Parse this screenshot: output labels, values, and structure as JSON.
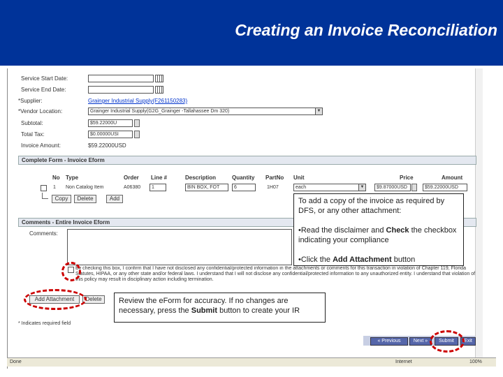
{
  "slide": {
    "title": "Creating an Invoice Reconciliation"
  },
  "form": {
    "service_start_label": "Service Start Date:",
    "service_end_label": "Service End Date:",
    "supplier_label": "*Supplier:",
    "supplier_value": "Grainger Industrial Supply(F261150283)",
    "vendor_location_label": "*Vendor Location:",
    "vendor_location_value": "Grainger Industrial Supply(G2G_Grainger -Tallahassee Dm 320)",
    "subtotal_label": "Subtotal:",
    "subtotal_value": "$59.22000U",
    "total_tax_label": "Total Tax:",
    "total_tax_value": "$0.00000USI",
    "invoice_amount_label": "Invoice Amount:",
    "invoice_amount_value": "$59.22000USD"
  },
  "complete_form": {
    "title": "Complete Form - Invoice Eform",
    "headers": [
      "No",
      "Type",
      "Order",
      "Line #",
      "Description",
      "Quantity",
      "PartNo",
      "Unit",
      "Price",
      "Amount"
    ],
    "row": {
      "no": "1",
      "type": "Non Catalog Item",
      "order": "A06380",
      "line": "1",
      "description": "BIN BOX, FOT",
      "quantity": "6",
      "partno": "1H07",
      "unit": "each",
      "price": "$9.87000USD",
      "amount": "$59.22000USD"
    },
    "copy_button": "Copy",
    "delete_button": "Delete",
    "add_button": "Add"
  },
  "comments_section": {
    "title": "Comments - Entire Invoice Eform",
    "comments_label": "Comments:",
    "disclaimer": "By checking this box, I confirm that I have not disclosed any confidential/protected information in the attachments or comments for this transaction in violation of Chapter 119, Florida Statutes, HIPAA, or any other state and/or federal laws. I understand that I will not disclose any confidential/protected information to any unauthorized entity. I understand that violation of this policy may result in disciplinary action including termination.",
    "add_attachment_button": "Add Attachment",
    "delete_button": "Delete",
    "required_note": "* Indicates required field"
  },
  "nav_buttons": {
    "previous": "« Previous",
    "next": "Next »",
    "submit": "Submit",
    "exit": "Exit"
  },
  "status_bar": {
    "left": "Done",
    "zone": "Internet",
    "zoom": "100%"
  },
  "callouts": {
    "top_line1": "To add a copy of the invoice as required by DFS, or any other attachment:",
    "top_bullet1_pre": "•Read the disclaimer and ",
    "top_bullet1_bold": "Check",
    "top_bullet1_post": " the checkbox indicating your compliance",
    "top_bullet2_pre": "•Click the ",
    "top_bullet2_bold": "Add Attachment",
    "top_bullet2_post": " button",
    "bottom_pre": "Review the eForm for accuracy.  If no changes are necessary, press the ",
    "bottom_bold": "Submit",
    "bottom_post": " button to create your IR"
  },
  "colors": {
    "header_bg": "#003399",
    "highlight": "#cc0000",
    "link": "#0033cc"
  }
}
